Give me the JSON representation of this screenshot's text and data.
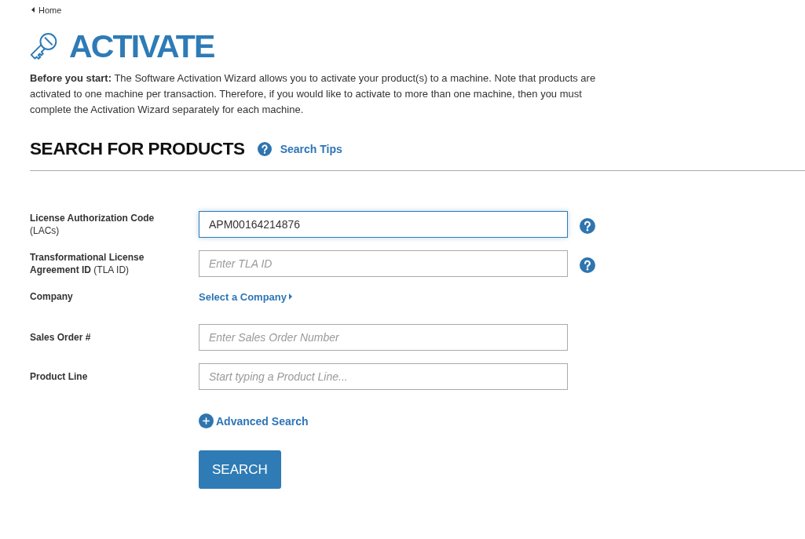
{
  "breadcrumb": {
    "label": "Home"
  },
  "title": "ACTIVATE",
  "intro": "**Before you start:** The Software Activation Wizard allows you to activate your product(s) to a machine. Note that products are activated to one machine per transaction. Therefore, if you would like to activate to more than one machine, then you must complete the Activation Wizard separately for each machine.",
  "section": {
    "title": "SEARCH FOR PRODUCTS",
    "tips_link": "Search Tips"
  },
  "fields": [
    {
      "kind": "input",
      "label": "License Authorization Code",
      "note": "(LACs)",
      "value": "APM00164214876",
      "focused": true,
      "help": true
    },
    {
      "kind": "input",
      "label": "Transformational License Agreement ID",
      "note": "(TLA ID)",
      "placeholder": "Enter TLA ID",
      "focused": false,
      "help": true
    },
    {
      "kind": "link",
      "label": "Company",
      "link": "Select a Company",
      "help": false
    },
    {
      "kind": "input",
      "label": "Sales Order #",
      "placeholder": "Enter Sales Order Number",
      "focused": false,
      "help": false
    },
    {
      "kind": "input",
      "label": "Product Line",
      "placeholder": "Start typing a Product Line...",
      "focused": false,
      "help": false
    }
  ],
  "advanced_search": {
    "label": "Advanced Search"
  },
  "search_button": {
    "label": "SEARCH"
  }
}
